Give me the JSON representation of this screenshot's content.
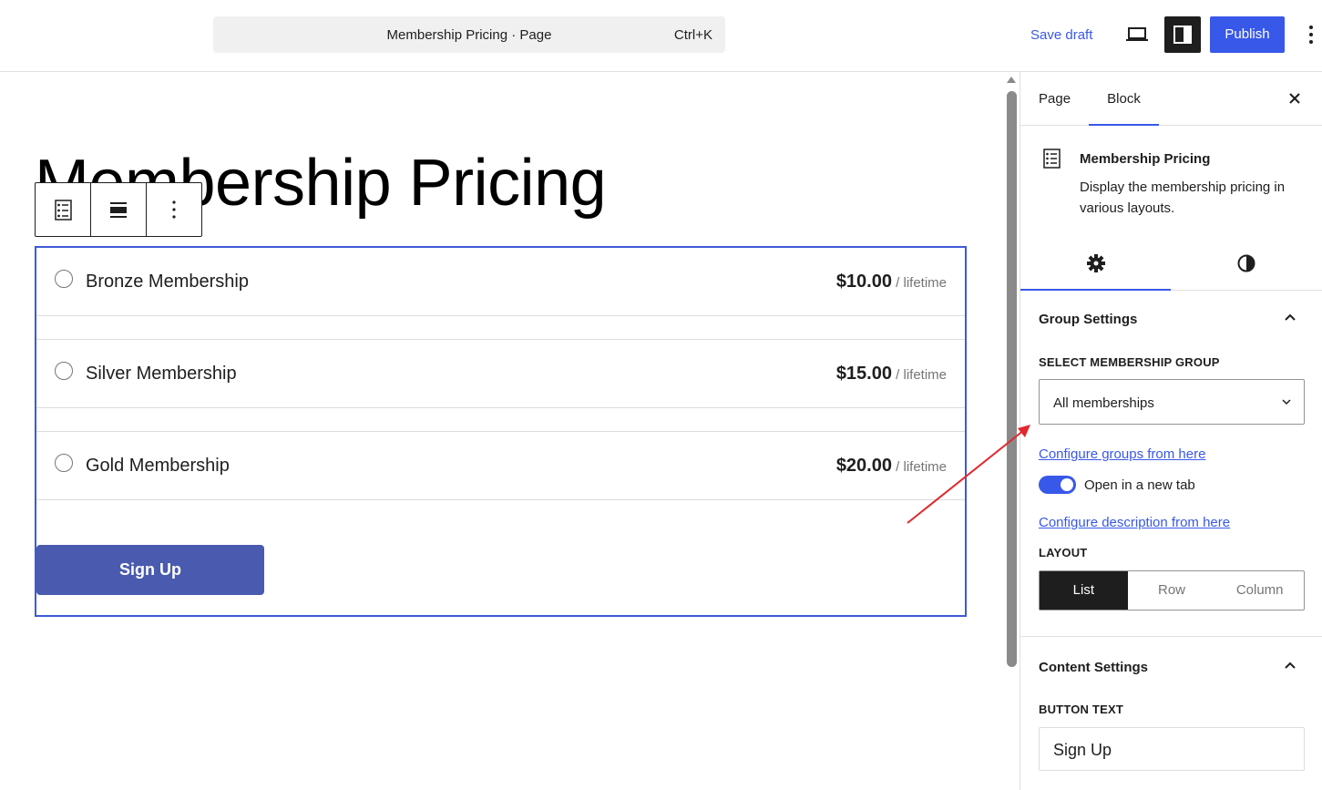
{
  "header": {
    "command_bar": {
      "title": "Membership Pricing · Page",
      "shortcut": "Ctrl+K"
    },
    "save_draft": "Save draft",
    "publish": "Publish",
    "icons": {
      "device_preview": "laptop-icon",
      "settings_panel": "sidebar-panel-icon",
      "more": "kebab-menu-icon"
    }
  },
  "editor": {
    "page_title": "Membership Pricing",
    "block_toolbar": {
      "icons": [
        "block-type-icon",
        "align-icon",
        "more-options-icon"
      ]
    },
    "plans": [
      {
        "name": "Bronze Membership",
        "price": "$10.00",
        "period": " / lifetime"
      },
      {
        "name": "Silver Membership",
        "price": "$15.00",
        "period": " / lifetime"
      },
      {
        "name": "Gold Membership",
        "price": "$20.00",
        "period": " / lifetime"
      }
    ],
    "signup_button": "Sign Up"
  },
  "sidebar": {
    "tabs": {
      "page": "Page",
      "block": "Block"
    },
    "block_card": {
      "name": "Membership Pricing",
      "description": "Display the membership pricing in various layouts."
    },
    "group_settings": {
      "title": "Group Settings",
      "select_label": "SELECT MEMBERSHIP GROUP",
      "select_value": "All memberships",
      "configure_groups_link": "Configure groups from here",
      "toggle_label": "Open in a new tab",
      "toggle_on": true,
      "configure_description_link": "Configure description from here",
      "layout_label": "LAYOUT",
      "layout_options": [
        "List",
        "Row",
        "Column"
      ],
      "layout_selected": "List"
    },
    "content_settings": {
      "title": "Content Settings",
      "button_text_label": "BUTTON TEXT",
      "button_text_value": "Sign Up"
    }
  },
  "colors": {
    "accent": "#3858e9",
    "block_border": "#3e5ad6",
    "signup_bg": "#4a5aae",
    "annotation_arrow": "#e0282e"
  }
}
